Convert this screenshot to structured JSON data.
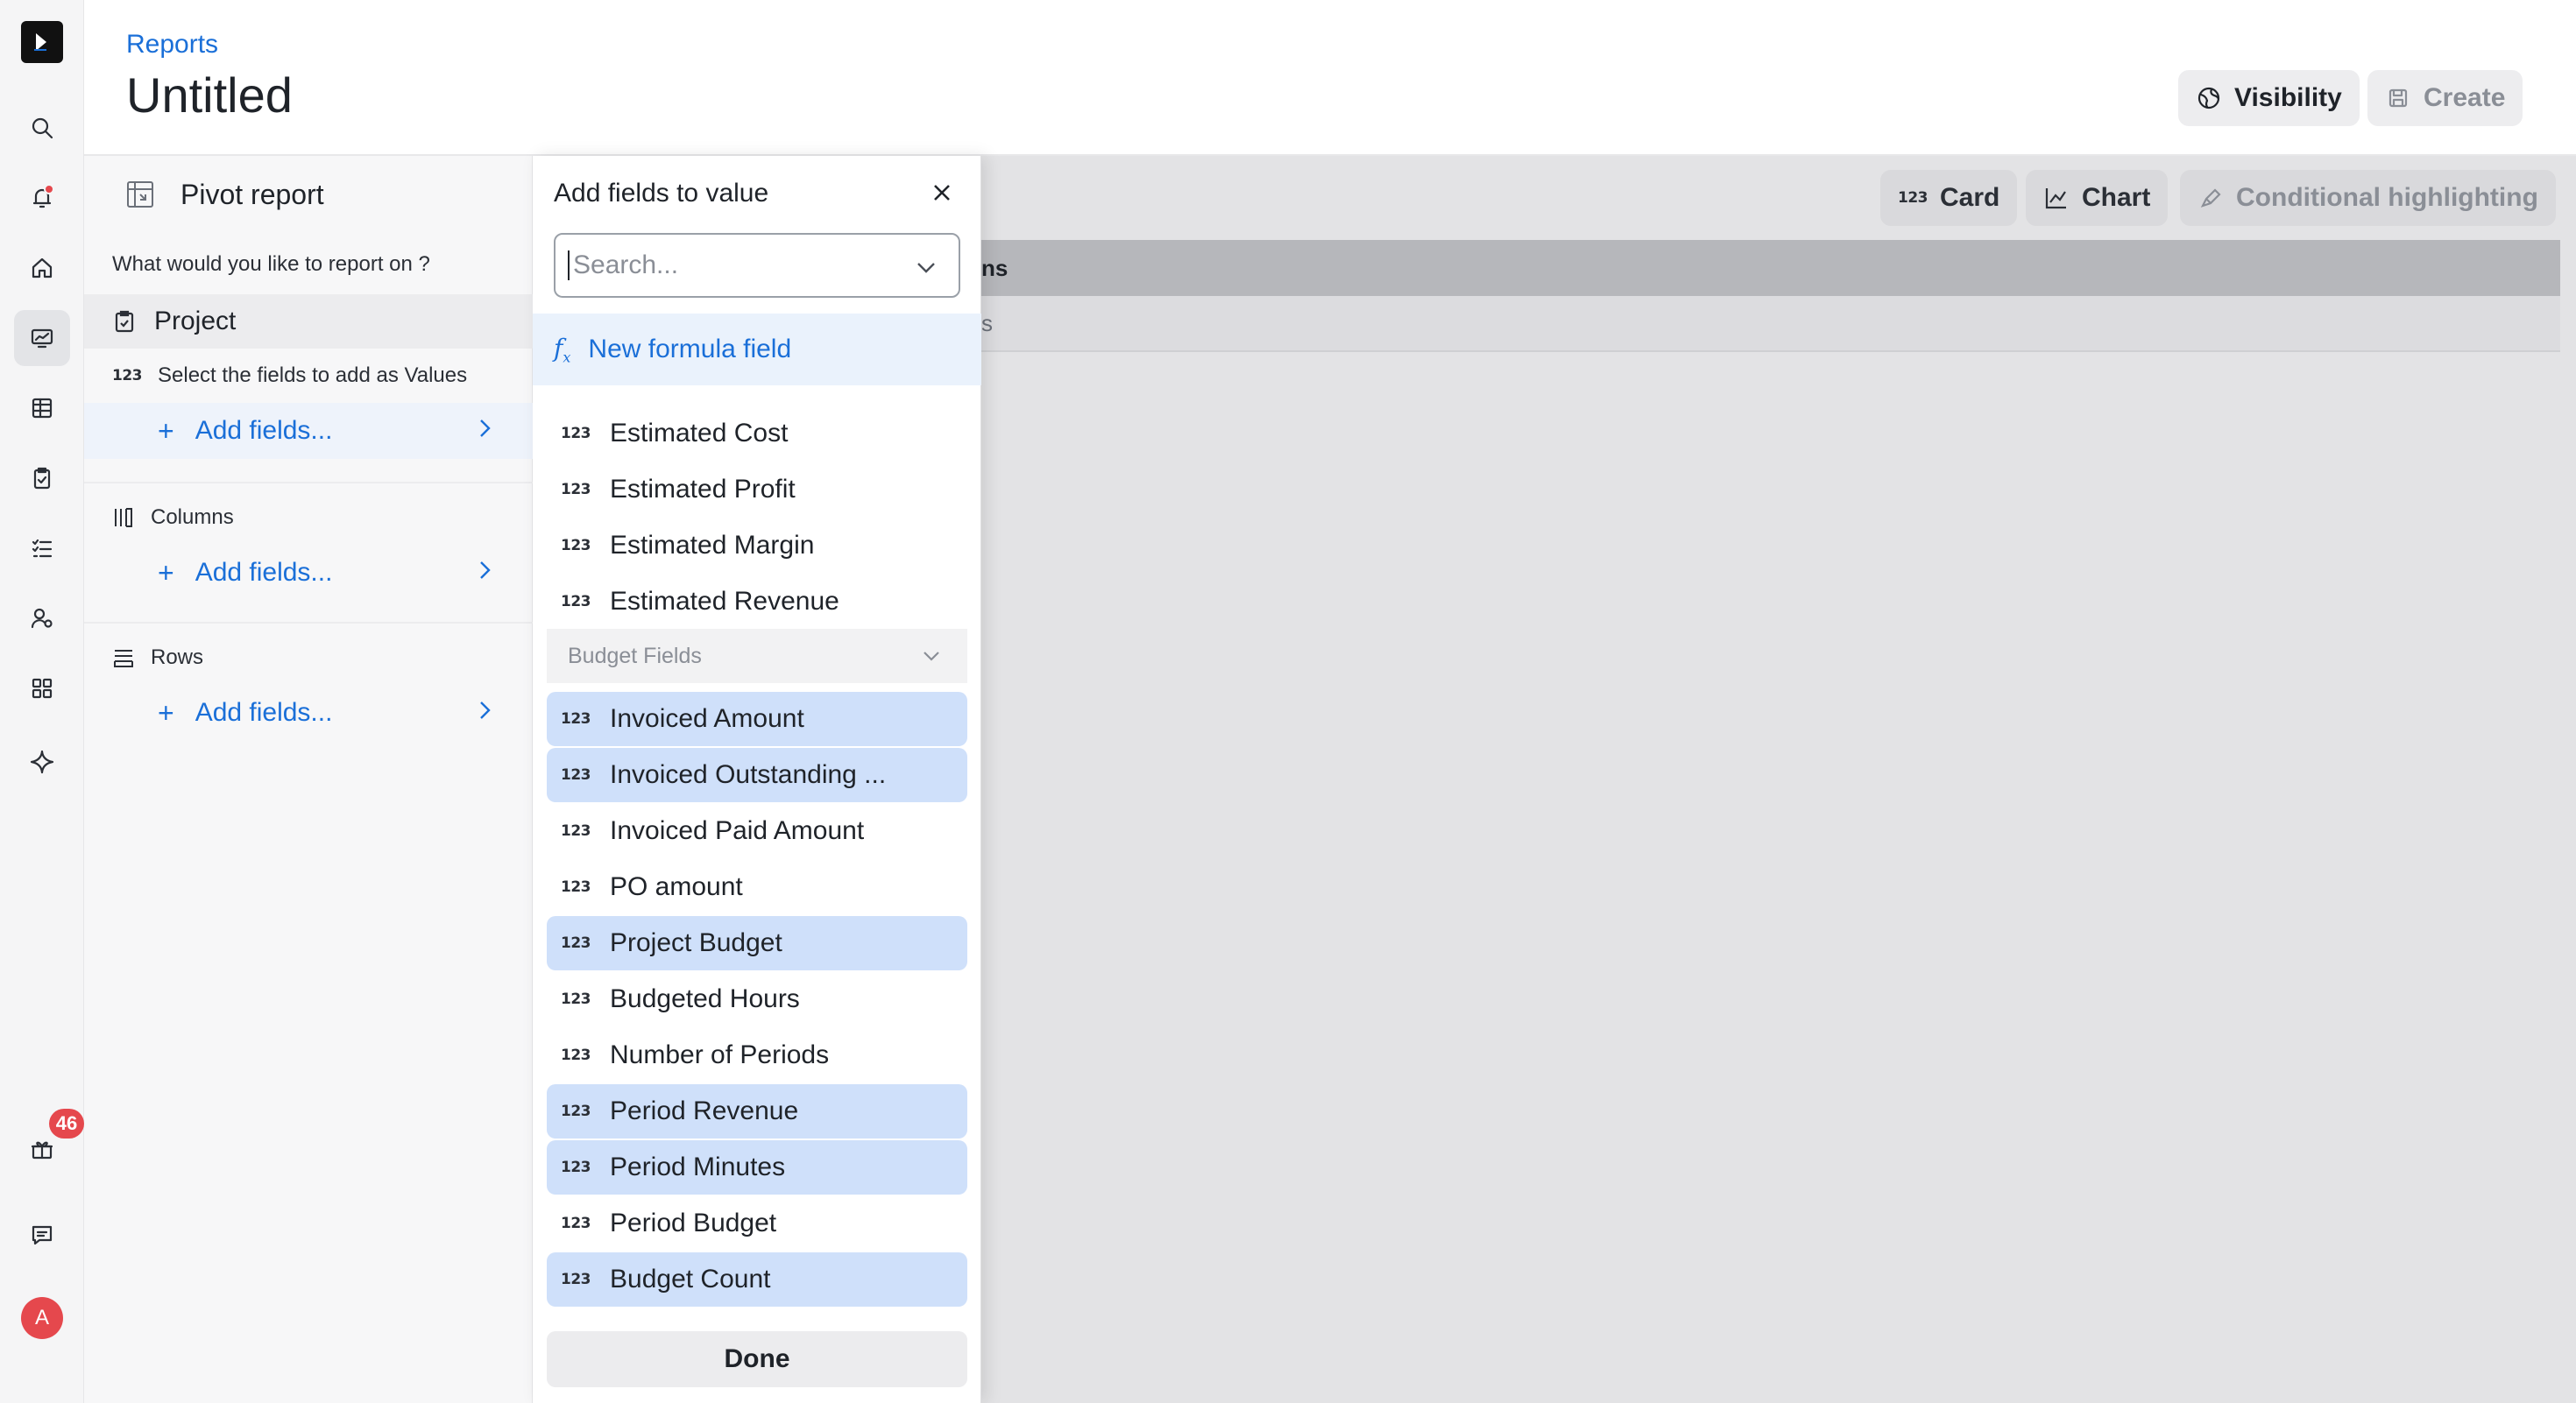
{
  "app": {
    "notifications_badge": "46",
    "avatar_initial": "A"
  },
  "header": {
    "breadcrumb": "Reports",
    "title": "Untitled",
    "visibility_label": "Visibility",
    "create_label": "Create"
  },
  "config": {
    "title": "Pivot report",
    "question": "What would you like to report on ?",
    "entity": "Project",
    "values_label": "Select the fields to add as Values",
    "values_add": "Add fields...",
    "columns_label": "Columns",
    "columns_add": "Add fields...",
    "rows_label": "Rows",
    "rows_add": "Add fields..."
  },
  "main": {
    "card_label": "Card",
    "chart_label": "Chart",
    "highlight_label": "Conditional highlighting",
    "grid_header_partial": "ns",
    "grid_row_partial": "s"
  },
  "dropdown": {
    "title": "Add fields to value",
    "search_placeholder": "Search...",
    "formula_label": "New formula field",
    "items_top": [
      {
        "label": "Estimated Cost",
        "selected": false
      },
      {
        "label": "Estimated Profit",
        "selected": false
      },
      {
        "label": "Estimated Margin",
        "selected": false
      },
      {
        "label": "Estimated Revenue",
        "selected": false
      }
    ],
    "group_label": "Budget Fields",
    "items_budget": [
      {
        "label": "Invoiced Amount",
        "selected": true
      },
      {
        "label": "Invoiced Outstanding ...",
        "selected": true
      },
      {
        "label": "Invoiced Paid Amount",
        "selected": false
      },
      {
        "label": "PO amount",
        "selected": false
      },
      {
        "label": "Project Budget",
        "selected": true
      },
      {
        "label": "Budgeted Hours",
        "selected": false
      },
      {
        "label": "Number of Periods",
        "selected": false
      },
      {
        "label": "Period Revenue",
        "selected": true
      },
      {
        "label": "Period Minutes",
        "selected": true
      },
      {
        "label": "Period Budget",
        "selected": false
      },
      {
        "label": "Budget Count",
        "selected": true
      }
    ],
    "done_label": "Done",
    "number_icon": "123"
  }
}
